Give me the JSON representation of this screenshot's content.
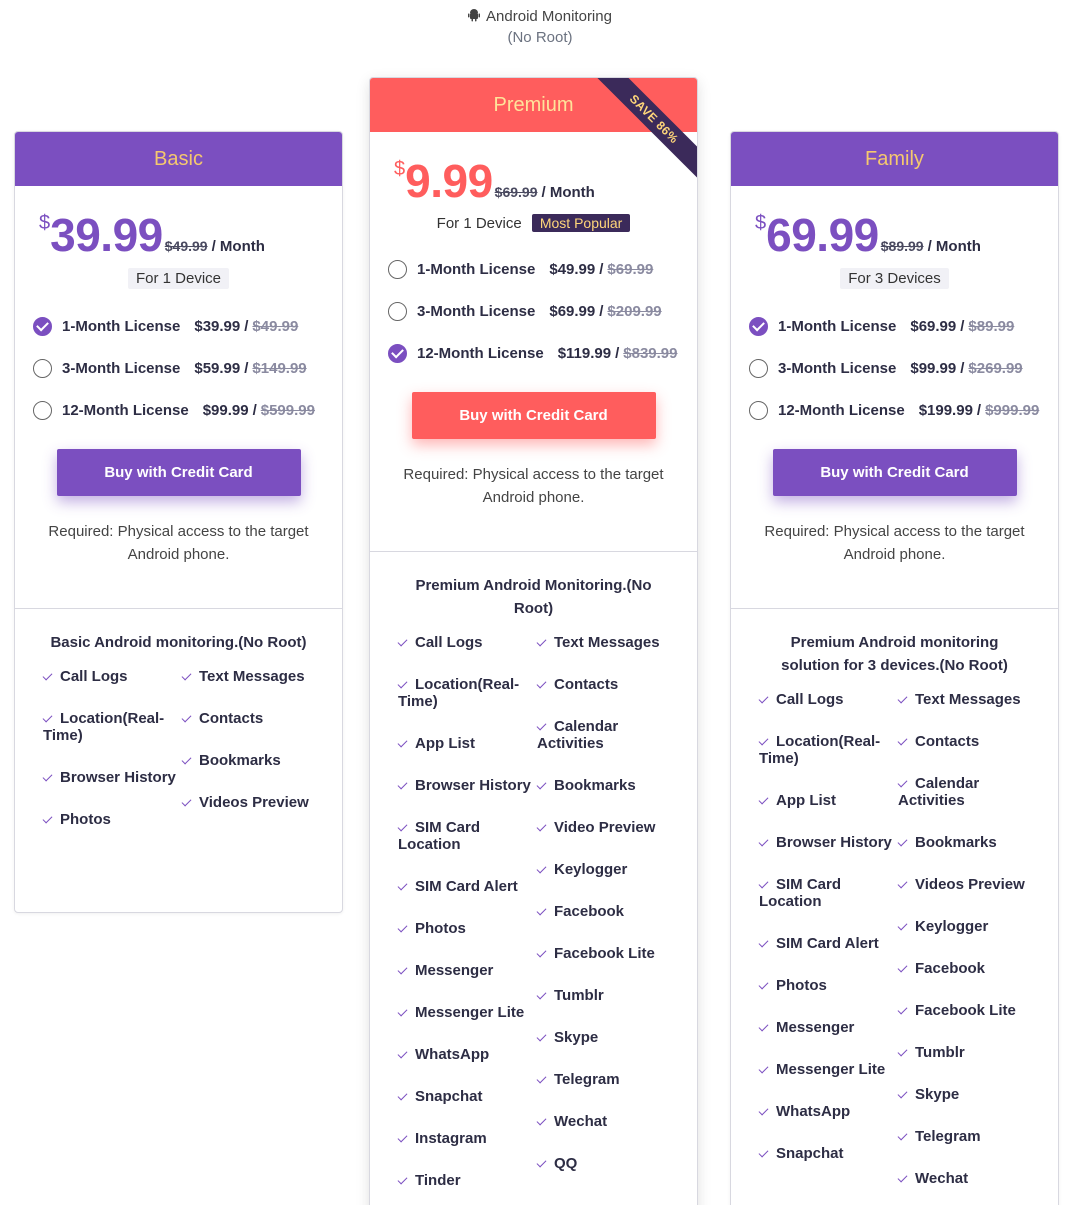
{
  "header": {
    "title": "Android Monitoring",
    "subtitle": "(No Root)"
  },
  "basic": {
    "name": "Basic",
    "currency": "$",
    "price": "39.99",
    "old_price": "$49.99",
    "per": "/ Month",
    "devices": "For 1 Device",
    "licenses": [
      {
        "name": "1-Month License",
        "price": "$39.99",
        "old": "$49.99",
        "selected": true
      },
      {
        "name": "3-Month License",
        "price": "$59.99",
        "old": "$149.99",
        "selected": false
      },
      {
        "name": "12-Month License",
        "price": "$99.99",
        "old": "$599.99",
        "selected": false
      }
    ],
    "buy_label": "Buy with Credit Card",
    "required": "Required: Physical access to the target Android phone.",
    "features_title": "Basic Android monitoring.(No Root)",
    "features_left": [
      "Call Logs",
      "Location(Real-Time)",
      "Browser History",
      "Photos"
    ],
    "features_right": [
      "Text Messages",
      "Contacts",
      "Bookmarks",
      "Videos Preview"
    ]
  },
  "premium": {
    "name": "Premium",
    "ribbon": "SAVE 86%",
    "currency": "$",
    "price": "9.99",
    "old_price": "$69.99",
    "per": "/ Month",
    "devices": "For 1 Device",
    "badge": "Most Popular",
    "licenses": [
      {
        "name": "1-Month License",
        "price": "$49.99",
        "old": "$69.99",
        "selected": false
      },
      {
        "name": "3-Month License",
        "price": "$69.99",
        "old": "$209.99",
        "selected": false
      },
      {
        "name": "12-Month License",
        "price": "$119.99",
        "old": "$839.99",
        "selected": true
      }
    ],
    "buy_label": "Buy with Credit Card",
    "required": "Required: Physical access to the target Android phone.",
    "features_title": "Premium Android Monitoring.(No Root)",
    "features_left": [
      "Call Logs",
      "Location(Real-Time)",
      "App List",
      "Browser History",
      "SIM Card Location",
      "SIM Card Alert",
      "Photos",
      "Messenger",
      "Messenger Lite",
      "WhatsApp",
      "Snapchat",
      "Instagram",
      "Tinder"
    ],
    "features_right": [
      "Text Messages",
      "Contacts",
      "Calendar Activities",
      "Bookmarks",
      "Video Preview",
      "Keylogger",
      "Facebook",
      "Facebook Lite",
      "Tumblr",
      "Skype",
      "Telegram",
      "Wechat",
      "QQ"
    ]
  },
  "family": {
    "name": "Family",
    "currency": "$",
    "price": "69.99",
    "old_price": "$89.99",
    "per": "/ Month",
    "devices": "For 3 Devices",
    "licenses": [
      {
        "name": "1-Month License",
        "price": "$69.99",
        "old": "$89.99",
        "selected": true
      },
      {
        "name": "3-Month License",
        "price": "$99.99",
        "old": "$269.99",
        "selected": false
      },
      {
        "name": "12-Month License",
        "price": "$199.99",
        "old": "$999.99",
        "selected": false
      }
    ],
    "buy_label": "Buy with Credit Card",
    "required": "Required: Physical access to the target Android phone.",
    "features_title": "Premium Android monitoring solution for 3 devices.(No Root)",
    "features_left": [
      "Call Logs",
      "Location(Real-Time)",
      "App List",
      "Browser History",
      "SIM Card Location",
      "SIM Card Alert",
      "Photos",
      "Messenger",
      "Messenger Lite",
      "WhatsApp",
      "Snapchat"
    ],
    "features_right": [
      "Text Messages",
      "Contacts",
      "Calendar Activities",
      "Bookmarks",
      "Videos Preview",
      "Keylogger",
      "Facebook",
      "Facebook Lite",
      "Tumblr",
      "Skype",
      "Telegram",
      "Wechat"
    ]
  },
  "colors": {
    "purple": "#7b4fc0",
    "red": "#ff5d5d",
    "gold": "#f5c86e",
    "dark": "#3b2a5a"
  },
  "icons": {
    "platform": "android-icon",
    "feature": "check-icon",
    "selected": "radio-checked-icon"
  }
}
